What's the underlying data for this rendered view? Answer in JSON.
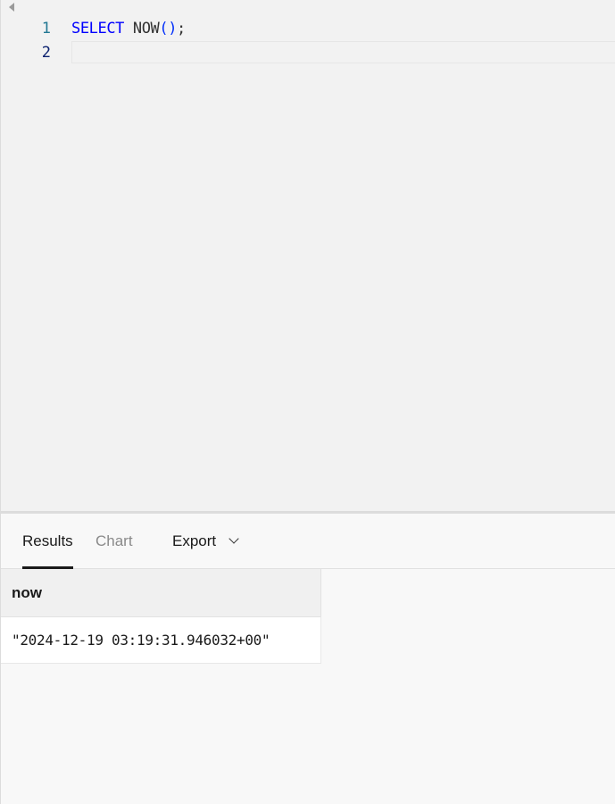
{
  "editor": {
    "lines": [
      {
        "number": "1",
        "tokens": {
          "keyword": "SELECT",
          "space": " ",
          "func": "NOW",
          "parens": "()",
          "punct": ";"
        }
      },
      {
        "number": "2",
        "text": ""
      }
    ]
  },
  "results": {
    "tabs": {
      "results_label": "Results",
      "chart_label": "Chart",
      "export_label": "Export"
    },
    "grid": {
      "columns": [
        "now"
      ],
      "rows": [
        [
          "\"2024-12-19 03:19:31.946032+00\""
        ]
      ]
    }
  },
  "colors": {
    "keyword": "#0000ff",
    "paren": "#0431fa",
    "line_number_active": "#237893",
    "active_tab_underline": "#1a1a1a"
  }
}
